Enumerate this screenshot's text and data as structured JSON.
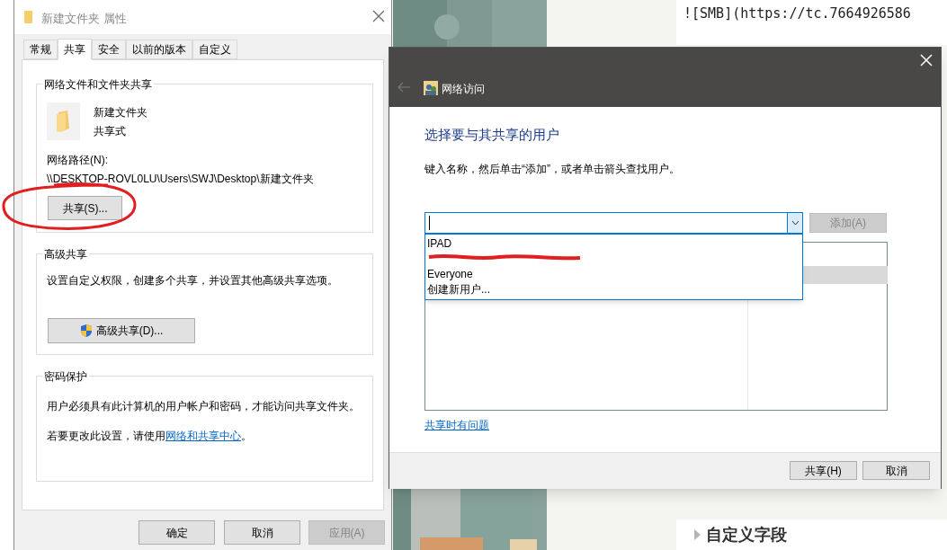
{
  "editor": {
    "text_line": "![SMB](https://tc.7664926586",
    "heading": "自定义字段"
  },
  "properties_window": {
    "title": "新建文件夹 属性",
    "tabs": [
      {
        "label": "常规",
        "selected": false
      },
      {
        "label": "共享",
        "selected": true
      },
      {
        "label": "安全",
        "selected": false
      },
      {
        "label": "以前的版本",
        "selected": false
      },
      {
        "label": "自定义",
        "selected": false
      }
    ],
    "network_sharing": {
      "title": "网络文件和文件夹共享",
      "folder_name": "新建文件夹",
      "share_state": "共享式",
      "path_label": "网络路径(N):",
      "path": "\\\\DESKTOP-ROVL0LU\\Users\\SWJ\\Desktop\\新建文件夹",
      "button": "共享(S)...",
      "annotated": true
    },
    "advanced_sharing": {
      "title": "高级共享",
      "description": "设置自定义权限，创建多个共享，并设置其他高级共享选项。",
      "button": "高级共享(D)..."
    },
    "password_protection": {
      "title": "密码保护",
      "description": "用户必须具有此计算机的用户帐户和密码，才能访问共享文件夹。",
      "hint": "若要更改此设置，请使用",
      "link": "网络和共享中心",
      "hint_end": "。"
    },
    "buttons": [
      {
        "label": "确定",
        "disabled": false
      },
      {
        "label": "取消",
        "disabled": false
      },
      {
        "label": "应用(A)",
        "disabled": true
      }
    ]
  },
  "network_dialog": {
    "title": "网络访问",
    "heading": "选择要与其共享的用户",
    "instruction": "键入名称，然后单击“添加”，或者单击箭头查找用户。",
    "add_button": {
      "label": "添加(A)",
      "disabled": true
    },
    "dropdown": [
      {
        "kind": "text",
        "label": "IPAD"
      },
      {
        "kind": "redacted"
      },
      {
        "kind": "text",
        "label": "Everyone"
      },
      {
        "kind": "text",
        "label": "创建新用户..."
      }
    ],
    "help_link": "共享时有问题",
    "buttons": [
      {
        "label": "共享(H)",
        "disabled": false
      },
      {
        "label": "取消",
        "disabled": false
      }
    ]
  }
}
